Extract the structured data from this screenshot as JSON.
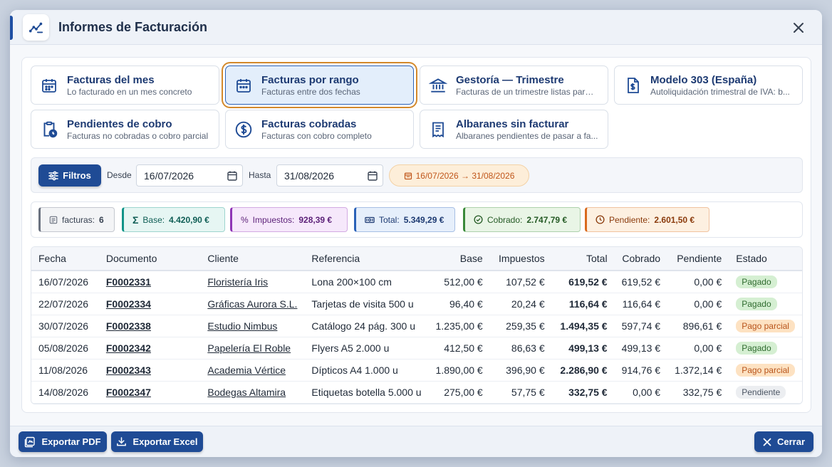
{
  "window": {
    "title": "Informes de Facturación"
  },
  "report_cards": [
    {
      "title": "Facturas del mes",
      "subtitle": "Lo facturado en un mes concreto",
      "icon": "calendar-icon",
      "active": false
    },
    {
      "title": "Facturas por rango",
      "subtitle": "Facturas entre dos fechas",
      "icon": "calendar-range-icon",
      "active": true
    },
    {
      "title": "Gestoría — Trimestre",
      "subtitle": "Facturas de un trimestre listas para ...",
      "icon": "bank-icon",
      "active": false
    },
    {
      "title": "Modelo 303 (España)",
      "subtitle": "Autoliquidación trimestral de IVA: b...",
      "icon": "tax-document-icon",
      "active": false
    },
    {
      "title": "Pendientes de cobro",
      "subtitle": "Facturas no cobradas o cobro parcial",
      "icon": "clipboard-clock-icon",
      "active": false
    },
    {
      "title": "Facturas cobradas",
      "subtitle": "Facturas con cobro completo",
      "icon": "dollar-circle-icon",
      "active": false
    },
    {
      "title": "Albaranes sin facturar",
      "subtitle": "Albaranes pendientes de pasar a fa...",
      "icon": "delivery-note-icon",
      "active": false
    }
  ],
  "filters": {
    "button_label": "Filtros",
    "from_label": "Desde",
    "from_value": "16/07/2026",
    "to_label": "Hasta",
    "to_value": "31/08/2026",
    "range_text": "16/07/2026 → 31/08/2026"
  },
  "summary": [
    {
      "label": "facturas:",
      "value": "6",
      "icon": "list-icon",
      "color": "#6b7280",
      "bg": "#f3f4f6",
      "text": "#374151"
    },
    {
      "label": "Base:",
      "value": "4.420,90 €",
      "icon": "sigma-icon",
      "color": "#0f9488",
      "bg": "#e6f6f3",
      "text": "#0f5e55"
    },
    {
      "label": "Impuestos:",
      "value": "928,39 €",
      "icon": "percent-icon",
      "color": "#8e33b5",
      "bg": "#f6e8fb",
      "text": "#5b1f78"
    },
    {
      "label": "Total:",
      "value": "5.349,29 €",
      "icon": "money-icon",
      "color": "#2b62b8",
      "bg": "#e6effb",
      "text": "#1d3a72"
    },
    {
      "label": "Cobrado:",
      "value": "2.747,79 €",
      "icon": "check-circle-icon",
      "color": "#3a8a3a",
      "bg": "#e9f5e6",
      "text": "#245a24"
    },
    {
      "label": "Pendiente:",
      "value": "2.601,50 €",
      "icon": "clock-icon",
      "color": "#d96a1e",
      "bg": "#fdf0e1",
      "text": "#8a3a0c"
    }
  ],
  "table": {
    "headers": [
      "Fecha",
      "Documento",
      "Cliente",
      "Referencia",
      "Base",
      "Impuestos",
      "Total",
      "Cobrado",
      "Pendiente",
      "Estado"
    ],
    "rows": [
      {
        "fecha": "16/07/2026",
        "documento": "F0002331",
        "cliente": "Floristería Iris",
        "referencia": "Lona 200×100 cm",
        "base": "512,00 €",
        "impuestos": "107,52 €",
        "total": "619,52 €",
        "cobrado": "619,52 €",
        "pendiente": "0,00 €",
        "estado": "Pagado"
      },
      {
        "fecha": "22/07/2026",
        "documento": "F0002334",
        "cliente": "Gráficas Aurora S.L.",
        "referencia": "Tarjetas de visita 500 u",
        "base": "96,40 €",
        "impuestos": "20,24 €",
        "total": "116,64 €",
        "cobrado": "116,64 €",
        "pendiente": "0,00 €",
        "estado": "Pagado"
      },
      {
        "fecha": "30/07/2026",
        "documento": "F0002338",
        "cliente": "Estudio Nimbus",
        "referencia": "Catálogo 24 pág. 300 u",
        "base": "1.235,00 €",
        "impuestos": "259,35 €",
        "total": "1.494,35 €",
        "cobrado": "597,74 €",
        "pendiente": "896,61 €",
        "estado": "Pago parcial"
      },
      {
        "fecha": "05/08/2026",
        "documento": "F0002342",
        "cliente": "Papelería El Roble",
        "referencia": "Flyers A5 2.000 u",
        "base": "412,50 €",
        "impuestos": "86,63 €",
        "total": "499,13 €",
        "cobrado": "499,13 €",
        "pendiente": "0,00 €",
        "estado": "Pagado"
      },
      {
        "fecha": "11/08/2026",
        "documento": "F0002343",
        "cliente": "Academia Vértice",
        "referencia": "Dípticos A4 1.000 u",
        "base": "1.890,00 €",
        "impuestos": "396,90 €",
        "total": "2.286,90 €",
        "cobrado": "914,76 €",
        "pendiente": "1.372,14 €",
        "estado": "Pago parcial"
      },
      {
        "fecha": "14/08/2026",
        "documento": "F0002347",
        "cliente": "Bodegas Altamira",
        "referencia": "Etiquetas botella 5.000 u",
        "base": "275,00 €",
        "impuestos": "57,75 €",
        "total": "332,75 €",
        "cobrado": "0,00 €",
        "pendiente": "332,75 €",
        "estado": "Pendiente"
      }
    ]
  },
  "status_colors": {
    "Pagado": {
      "bg": "#d5efd2",
      "fg": "#2f6b2f"
    },
    "Pago parcial": {
      "bg": "#fde2c2",
      "fg": "#b8531a"
    },
    "Pendiente": {
      "bg": "#eceef1",
      "fg": "#4b5563"
    }
  },
  "footer": {
    "export_pdf": "Exportar PDF",
    "export_excel": "Exportar Excel",
    "close": "Cerrar"
  }
}
